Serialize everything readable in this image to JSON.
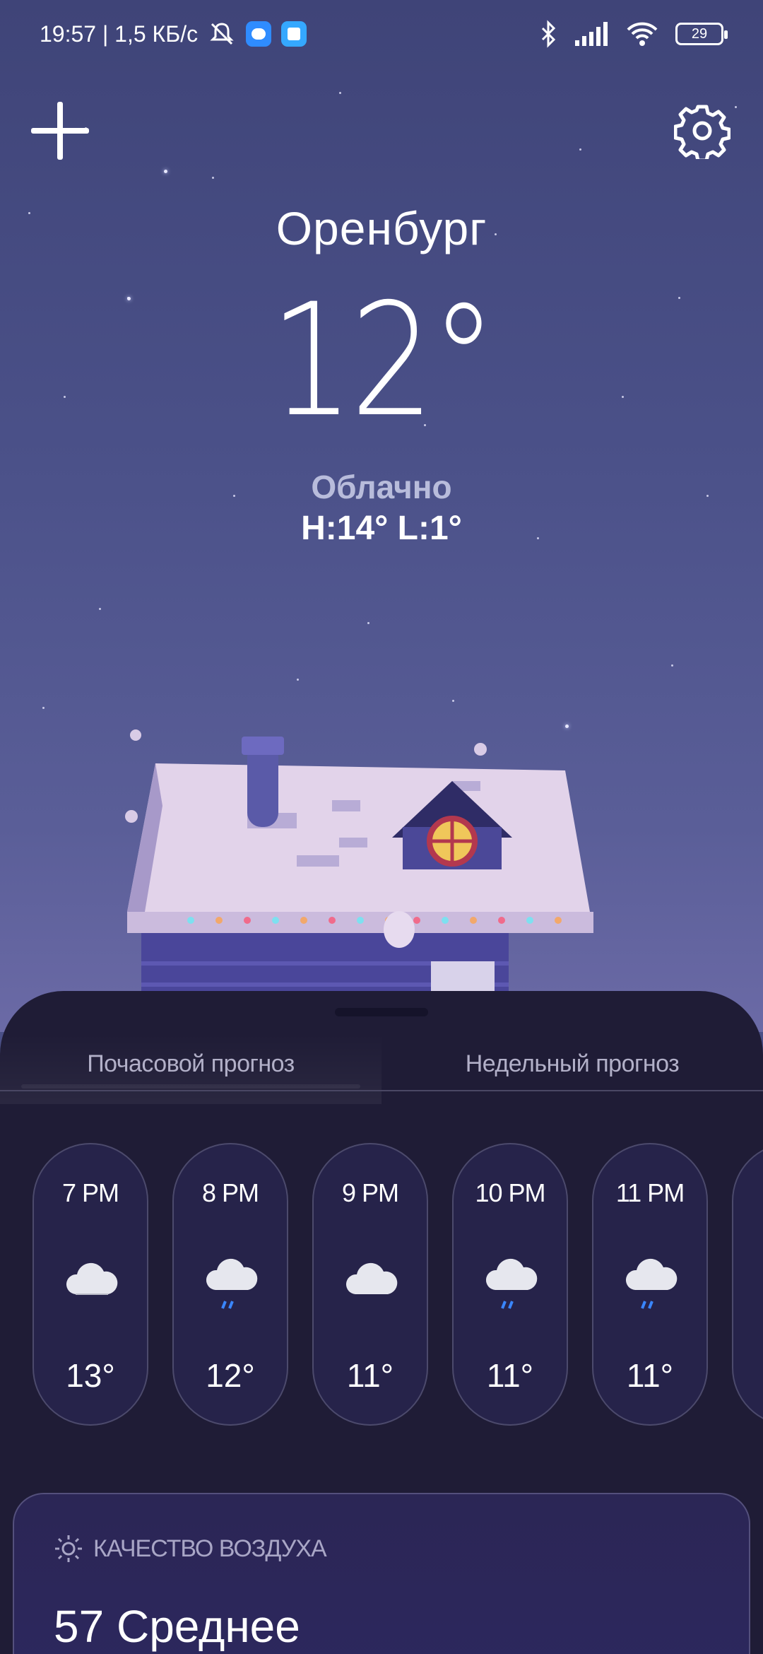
{
  "status_bar": {
    "time_net": "19:57 | 1,5 КБ/с",
    "battery": "29"
  },
  "weather": {
    "city": "Оренбург",
    "temperature": "12°",
    "condition": "Облачно",
    "hi_lo": "H:14°  L:1°"
  },
  "tabs": {
    "hourly": "Почасовой прогноз",
    "weekly": "Недельный прогноз"
  },
  "hourly": [
    {
      "time": "7 PM",
      "icon": "cloud-icon",
      "temp": "13°"
    },
    {
      "time": "8 PM",
      "icon": "cloud-rain-icon",
      "temp": "12°"
    },
    {
      "time": "9 PM",
      "icon": "cloud-icon",
      "temp": "11°"
    },
    {
      "time": "10 PM",
      "icon": "cloud-rain-icon",
      "temp": "11°"
    },
    {
      "time": "11 PM",
      "icon": "cloud-rain-icon",
      "temp": "11°"
    }
  ],
  "air_quality": {
    "title": "КАЧЕСТВО ВОЗДУХА",
    "value": "57 Среднее"
  },
  "colors": {
    "sky": "#4b5189",
    "sheet": "#1f1c36",
    "card": "#26234a",
    "rain": "#3a86ff"
  }
}
